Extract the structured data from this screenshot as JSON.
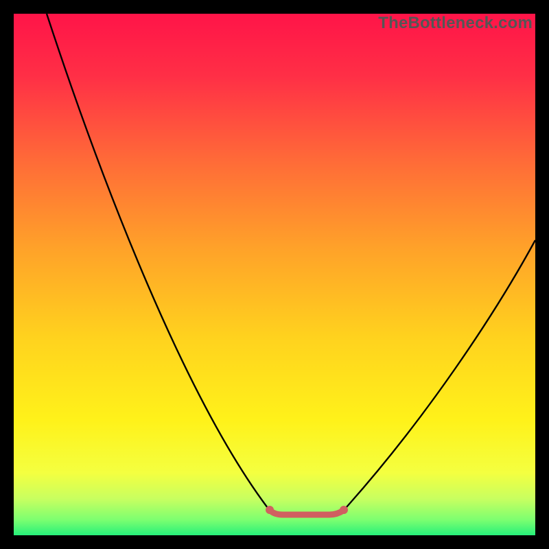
{
  "watermark": "TheBottleneck.com",
  "colors": {
    "frame": "#000000",
    "curve": "#000000",
    "optimal_segment": "#d06060",
    "gradient_top": "#ff1448",
    "gradient_bottom": "#26f07a",
    "watermark": "#555555"
  },
  "chart_data": {
    "type": "line",
    "title": "",
    "xlabel": "",
    "ylabel": "",
    "xlim": [
      0,
      100
    ],
    "ylim": [
      0,
      100
    ],
    "grid": false,
    "legend": false,
    "annotations": [
      "TheBottleneck.com"
    ],
    "series": [
      {
        "name": "bottleneck-curve",
        "color": "#000000",
        "x": [
          6,
          12,
          20,
          30,
          40,
          48,
          52,
          57,
          61,
          65,
          72,
          80,
          90,
          100
        ],
        "y": [
          100,
          82,
          62,
          40,
          20,
          6,
          4,
          4,
          4,
          6,
          16,
          30,
          46,
          57
        ]
      },
      {
        "name": "optimal-zone",
        "color": "#d06060",
        "x": [
          49,
          52,
          57,
          61,
          63
        ],
        "y": [
          5,
          4,
          4,
          4,
          5
        ]
      }
    ],
    "background_gradient": {
      "direction": "vertical",
      "stops": [
        {
          "pos": 0.0,
          "color": "#ff1448"
        },
        {
          "pos": 0.12,
          "color": "#ff2f46"
        },
        {
          "pos": 0.28,
          "color": "#ff6a38"
        },
        {
          "pos": 0.45,
          "color": "#ffa229"
        },
        {
          "pos": 0.62,
          "color": "#ffd21e"
        },
        {
          "pos": 0.78,
          "color": "#fff21a"
        },
        {
          "pos": 0.88,
          "color": "#f4ff40"
        },
        {
          "pos": 0.93,
          "color": "#c8ff60"
        },
        {
          "pos": 0.97,
          "color": "#7dff70"
        },
        {
          "pos": 1.0,
          "color": "#26f07a"
        }
      ]
    }
  }
}
